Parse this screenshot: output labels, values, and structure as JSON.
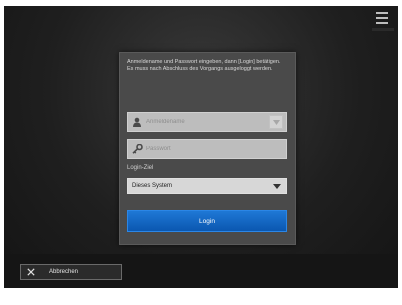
{
  "dialog": {
    "instructions": "Anmeldename und Passwort eingeben, dann [Login] betätigen. Es muss nach Abschluss des Vorgangs ausgeloggt werden."
  },
  "username": {
    "placeholder": "Anmeldename",
    "icon": "user-icon"
  },
  "password": {
    "placeholder": "Passwort",
    "icon": "key-icon"
  },
  "login_target": {
    "label": "Login-Ziel",
    "selected": "Dieses System"
  },
  "login_button": {
    "label": "Login"
  },
  "cancel_button": {
    "label": "Abbrechen",
    "icon": "close-icon"
  },
  "menu": {
    "icon": "hamburger-menu-icon"
  },
  "colors": {
    "accent": "#0b57b0",
    "background": "#1f1f1f"
  }
}
